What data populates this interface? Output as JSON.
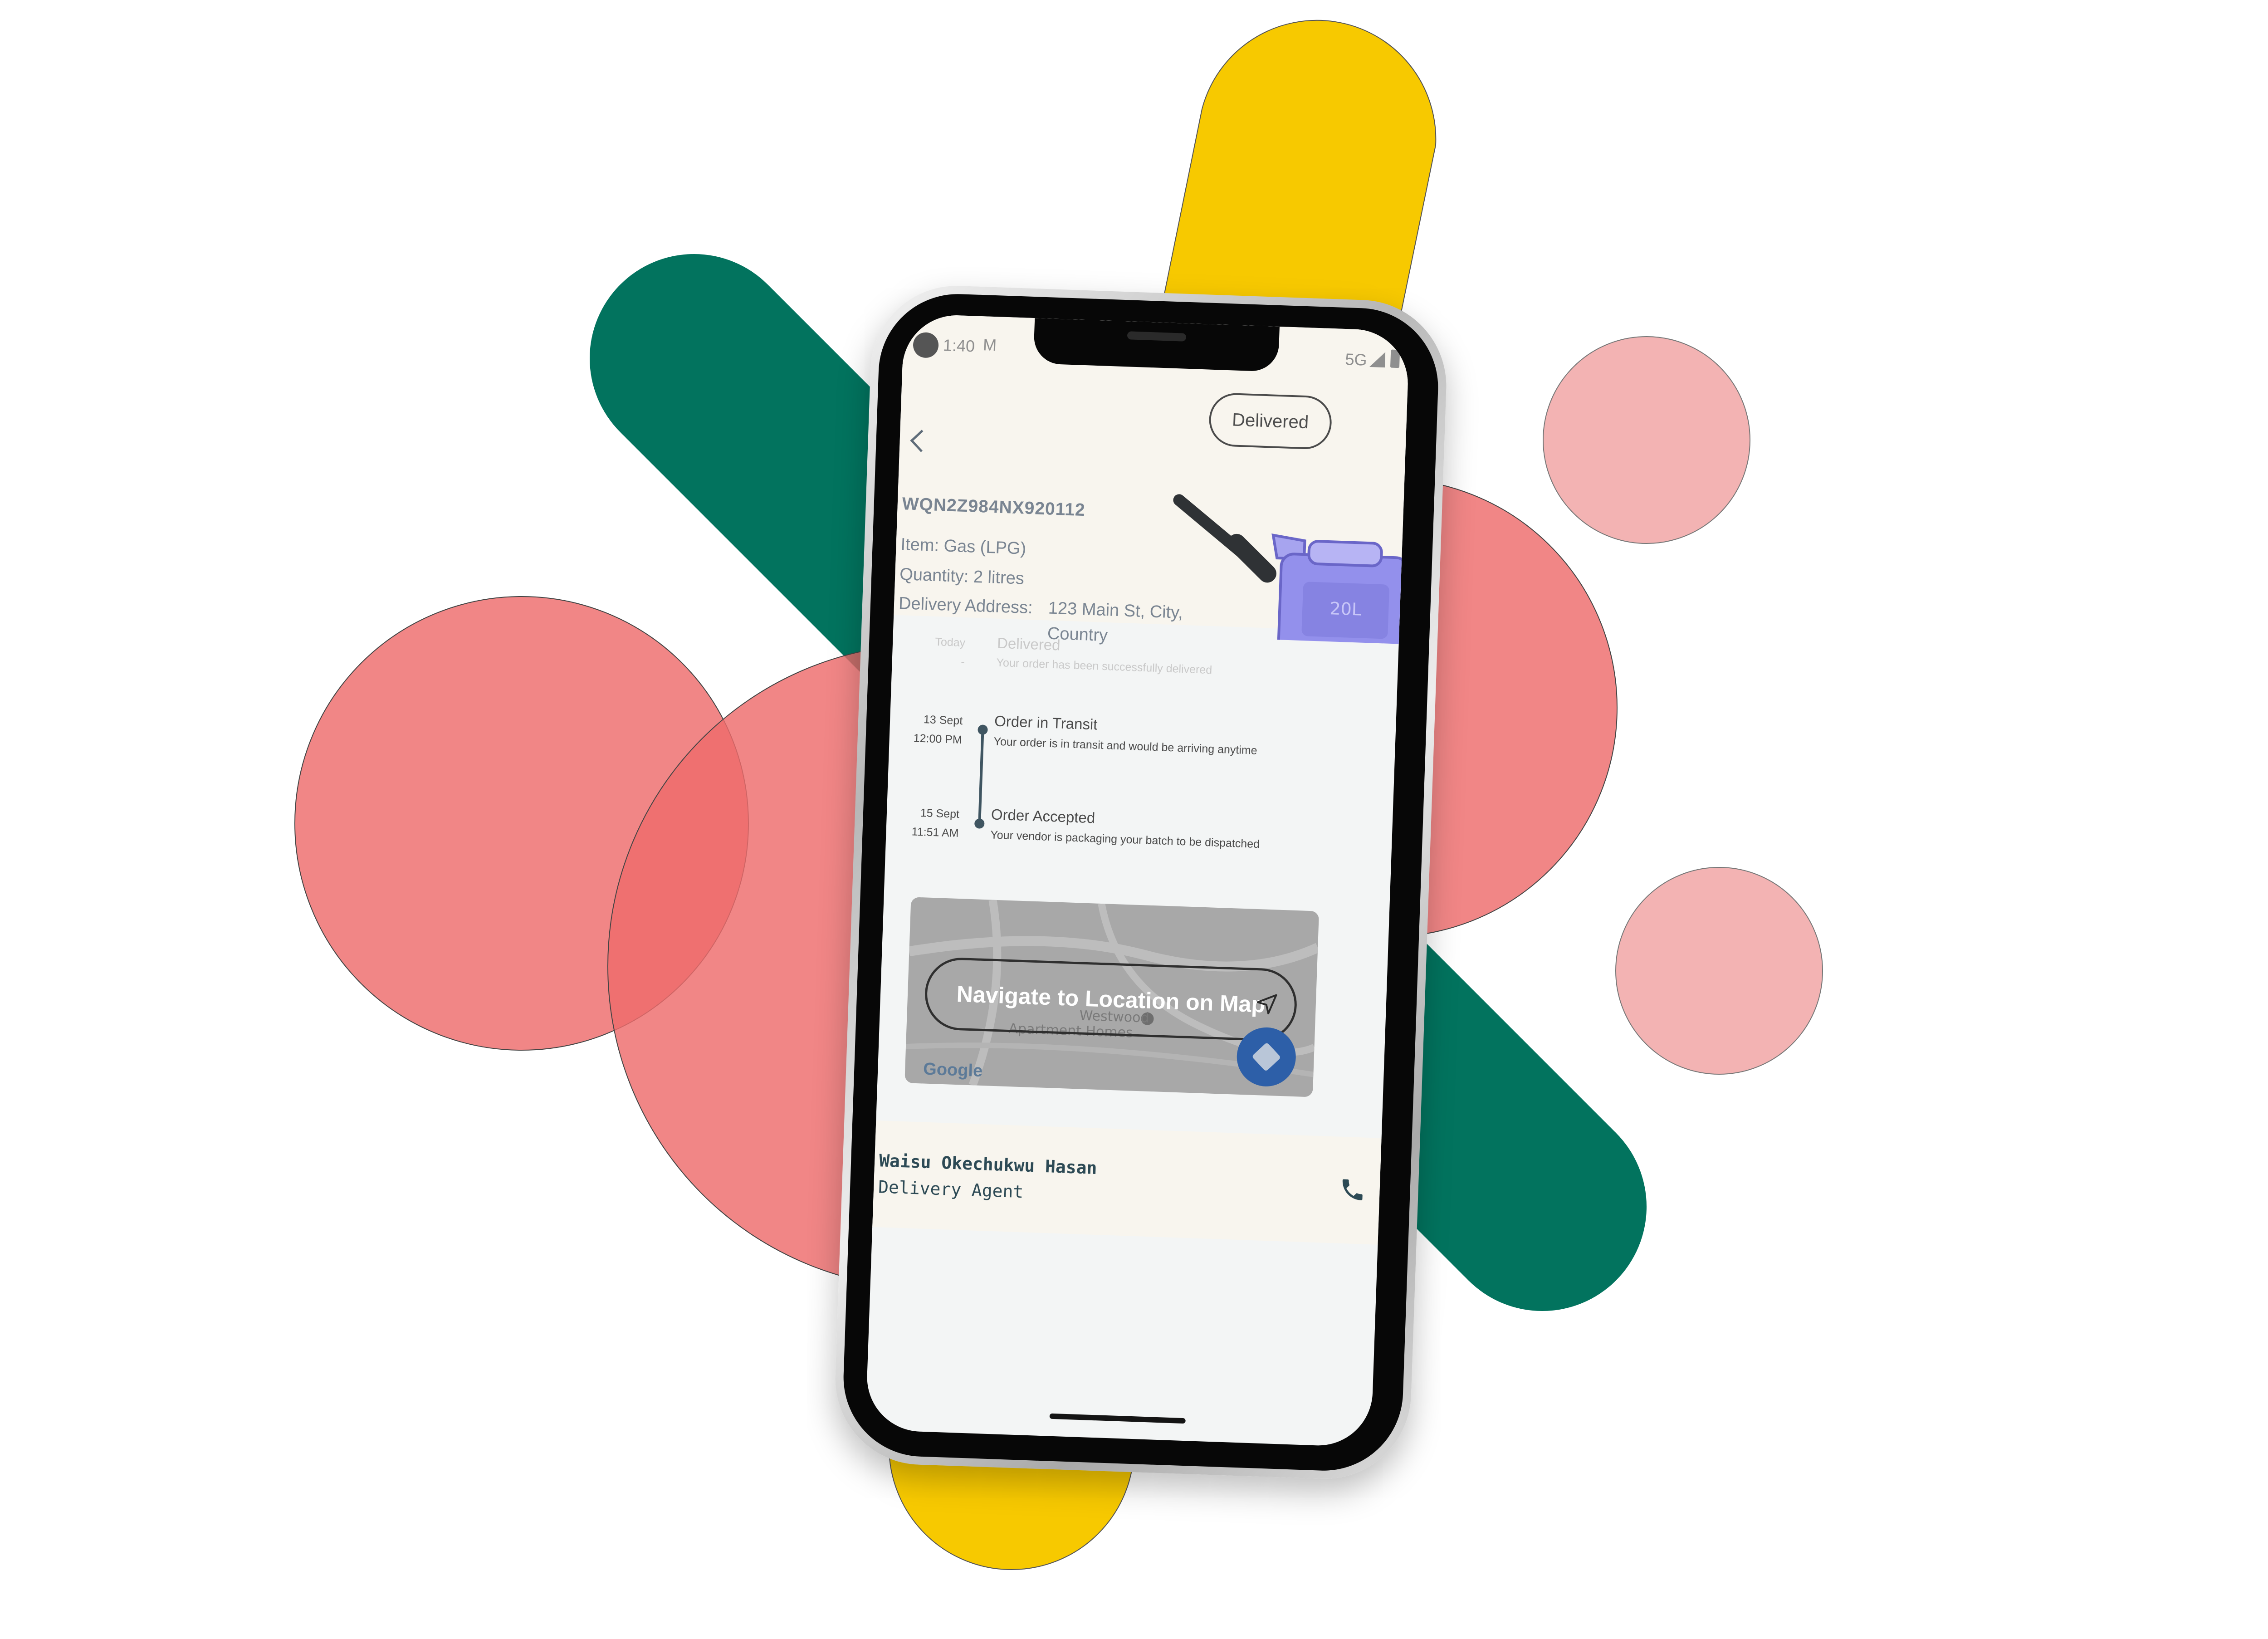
{
  "status_bar": {
    "time": "1:40",
    "mail_icon": "M",
    "network": "5G"
  },
  "order": {
    "status": "Delivered",
    "id": "WQN2Z984NX920112",
    "item_label": "Item:",
    "item_value": "Gas (LPG)",
    "quantity_label": "Quantity:",
    "quantity_value": "2 litres",
    "address_label": "Delivery Address:",
    "address_line1": "123 Main St, City,",
    "address_line2": "Country",
    "illustration": "jerry-can-illustration"
  },
  "timeline": [
    {
      "date": "Today",
      "time": "-",
      "title": "Delivered",
      "desc": "Your order has been successfully delivered",
      "state": "pending"
    },
    {
      "date": "13 Sept",
      "time": "12:00 PM",
      "title": "Order in Transit",
      "desc": "Your order is in transit and would be arriving anytime",
      "state": "done"
    },
    {
      "date": "15 Sept",
      "time": "11:51 AM",
      "title": "Order Accepted",
      "desc": "Your vendor is packaging your batch to be dispatched",
      "state": "done"
    }
  ],
  "map": {
    "navigate_label": "Navigate to Location on Map",
    "attribution": "Google",
    "place_labels": [
      "Westwood",
      "Apartment Homes"
    ]
  },
  "agent": {
    "name": "Waisu Okechukwu Hasan",
    "role": "Delivery Agent"
  },
  "colors": {
    "green": "#02735e",
    "yellow": "#f7c900",
    "red": "#ee6b6b",
    "pink": "#f3b3b3",
    "accent_blue": "#2d5fa8"
  }
}
